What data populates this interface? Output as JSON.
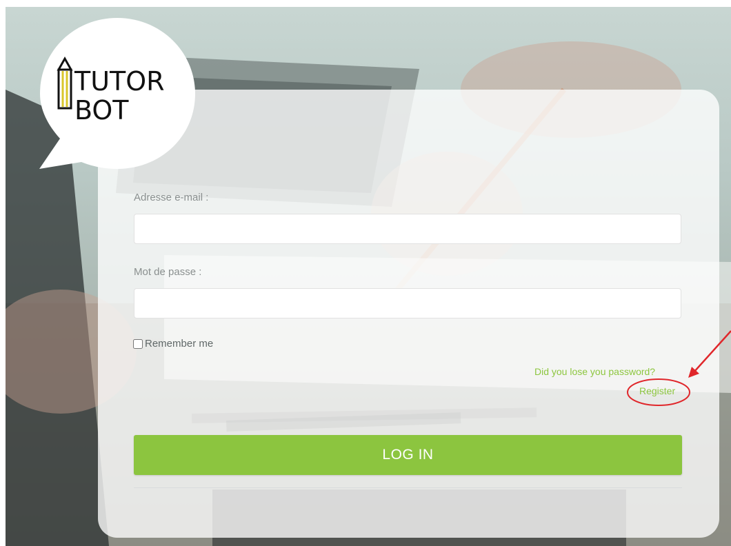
{
  "logo": {
    "line1": "TUTOR",
    "line2": "BOT",
    "accent_color": "#8dc63f"
  },
  "form": {
    "email_label": "Adresse e-mail :",
    "email_value": "",
    "password_label": "Mot de passe :",
    "password_value": "",
    "remember_label": "Remember me",
    "remember_checked": false,
    "lost_password_link": "Did you lose you password?",
    "register_link": "Register",
    "login_button": "LOG IN"
  },
  "annotations": {
    "arrow_color": "#e0262a",
    "highlight_target": "Register"
  },
  "colors": {
    "brand_green": "#8cc53f",
    "link_green": "#8dc63f",
    "label_gray": "#8a8f8f"
  }
}
